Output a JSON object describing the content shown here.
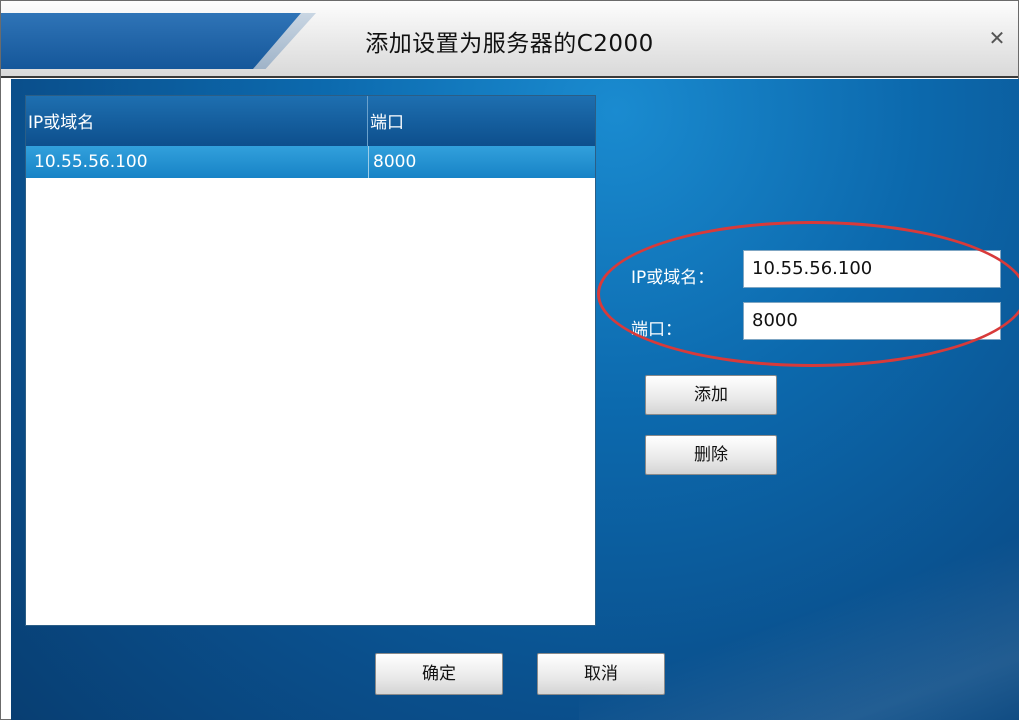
{
  "window": {
    "title": "添加设置为服务器的C2000",
    "close_glyph": "✕"
  },
  "list": {
    "columns": [
      "IP或域名",
      "端口"
    ],
    "rows": [
      {
        "ip": "10.55.56.100",
        "port": "8000"
      }
    ]
  },
  "form": {
    "ip_label": "IP或域名：",
    "ip_value": "10.55.56.100",
    "port_label": "端口：",
    "port_value": "8000"
  },
  "buttons": {
    "add": "添加",
    "delete": "删除",
    "ok": "确定",
    "cancel": "取消"
  },
  "colors": {
    "accent": "#0c69ad",
    "selection": "#1783c6",
    "highlight_oval": "#d83a3a"
  }
}
